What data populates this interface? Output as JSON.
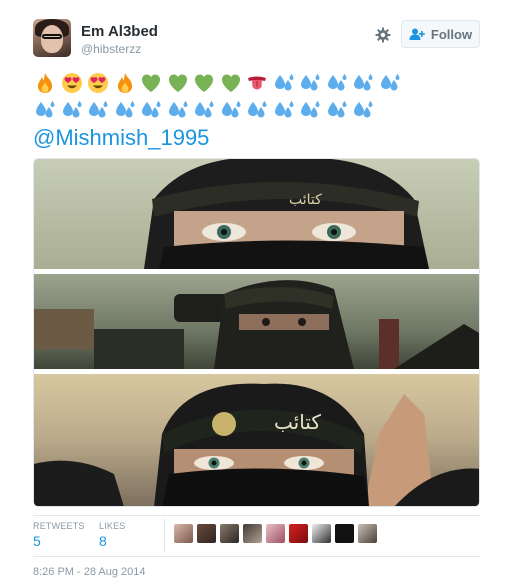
{
  "user": {
    "display_name": "Em Al3bed",
    "handle": "@hibsterzz"
  },
  "header": {
    "follow_label": "Follow"
  },
  "tweet": {
    "emoji_row1": [
      "fire",
      "heart-eyes",
      "heart-eyes",
      "fire",
      "green-heart",
      "green-heart",
      "green-heart",
      "green-heart",
      "tongue",
      "sweat-drops",
      "sweat-drops",
      "sweat-drops",
      "sweat-drops",
      "sweat-drops"
    ],
    "emoji_row2": [
      "sweat-drops",
      "sweat-drops",
      "sweat-drops",
      "sweat-drops",
      "sweat-drops",
      "sweat-drops",
      "sweat-drops",
      "sweat-drops",
      "sweat-drops",
      "sweat-drops",
      "sweat-drops",
      "sweat-drops",
      "sweat-drops"
    ],
    "mention": "@Mishmish_1995"
  },
  "media": {
    "panel_count": 3
  },
  "stats": {
    "retweets_label": "RETWEETS",
    "retweets_value": "5",
    "likes_label": "LIKES",
    "likes_value": "8"
  },
  "likers": [
    "avatar-1",
    "avatar-2",
    "avatar-3",
    "avatar-4",
    "avatar-5",
    "avatar-6",
    "avatar-7",
    "avatar-8"
  ],
  "timestamp": "8:26 PM - 28 Aug 2014",
  "colors": {
    "link": "#1b95e0",
    "muted": "#8899a6",
    "text": "#292f33",
    "border": "#e1e8ed"
  }
}
